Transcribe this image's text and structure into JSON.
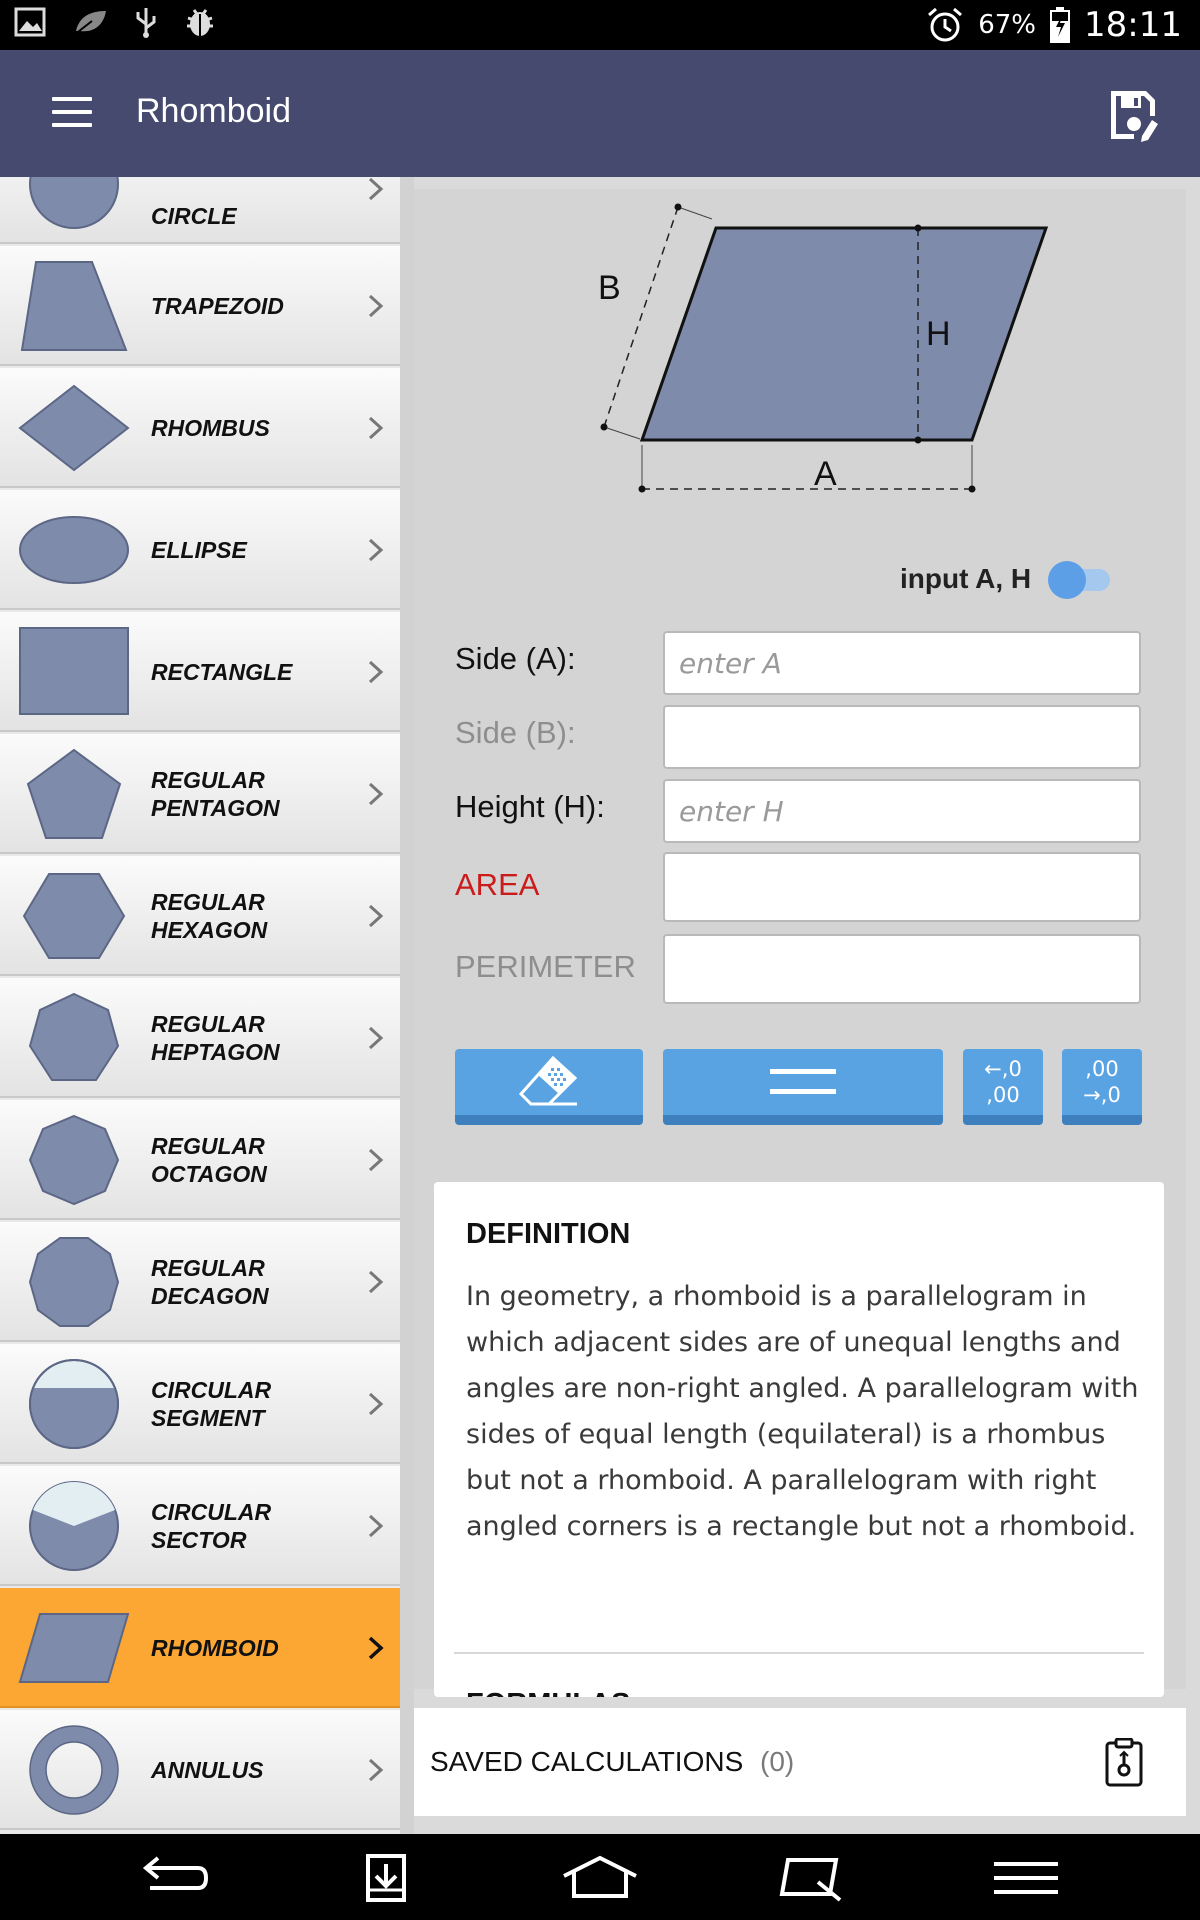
{
  "status_bar": {
    "battery": "67%",
    "time": "18:11"
  },
  "app_bar": {
    "title": "Rhomboid"
  },
  "sidebar": {
    "items": [
      {
        "label": "CIRCLE",
        "icon": "circle-shape-icon"
      },
      {
        "label": "TRAPEZOID",
        "icon": "trapezoid-shape-icon"
      },
      {
        "label": "RHOMBUS",
        "icon": "rhombus-shape-icon"
      },
      {
        "label": "ELLIPSE",
        "icon": "ellipse-shape-icon"
      },
      {
        "label": "RECTANGLE",
        "icon": "rectangle-shape-icon"
      },
      {
        "label": "REGULAR\nPENTAGON",
        "icon": "pentagon-shape-icon"
      },
      {
        "label": "REGULAR\nHEXAGON",
        "icon": "hexagon-shape-icon"
      },
      {
        "label": "REGULAR\nHEPTAGON",
        "icon": "heptagon-shape-icon"
      },
      {
        "label": "REGULAR\nOCTAGON",
        "icon": "octagon-shape-icon"
      },
      {
        "label": "REGULAR\nDECAGON",
        "icon": "decagon-shape-icon"
      },
      {
        "label": "CIRCULAR\nSEGMENT",
        "icon": "circular-segment-shape-icon"
      },
      {
        "label": "CIRCULAR\nSECTOR",
        "icon": "circular-sector-shape-icon"
      },
      {
        "label": "RHOMBOID",
        "icon": "rhomboid-shape-icon",
        "active": true
      },
      {
        "label": "ANNULUS",
        "icon": "annulus-shape-icon"
      }
    ]
  },
  "diagram": {
    "label_a": "A",
    "label_b": "B",
    "label_h": "H"
  },
  "toggle": {
    "label": "input A, H",
    "state": "on"
  },
  "fields": {
    "side_a": {
      "label": "Side (A):",
      "placeholder": "enter A",
      "value": ""
    },
    "side_b": {
      "label": "Side (B):",
      "placeholder": "",
      "value": ""
    },
    "height": {
      "label": "Height (H):",
      "placeholder": "enter H",
      "value": ""
    },
    "area": {
      "label": "AREA",
      "value": ""
    },
    "perimeter": {
      "label": "PERIMETER",
      "value": ""
    }
  },
  "buttons": {
    "clear": "eraser-icon",
    "calculate": "equals-icon",
    "decrease_decimals": "←,0\n,00",
    "increase_decimals": ",00\n→,0"
  },
  "definition": {
    "title": "DEFINITION",
    "text": "In geometry, a rhomboid is a parallelogram in which adjacent sides are of unequal lengths and angles are non-right angled. A parallelogram with sides of equal length (equilateral) is a rhombus but not a rhomboid. A parallelogram with right angled corners is a rectangle but not a rhomboid.",
    "formulas_title": "FORMULAS"
  },
  "saved": {
    "label": "SAVED CALCULATIONS",
    "count": "(0)"
  },
  "colors": {
    "app_bar": "#454a6e",
    "shape_fill": "#7e8bab",
    "active_item": "#fca734",
    "button": "#5aa3e3",
    "area_label": "#cc1b1b"
  }
}
